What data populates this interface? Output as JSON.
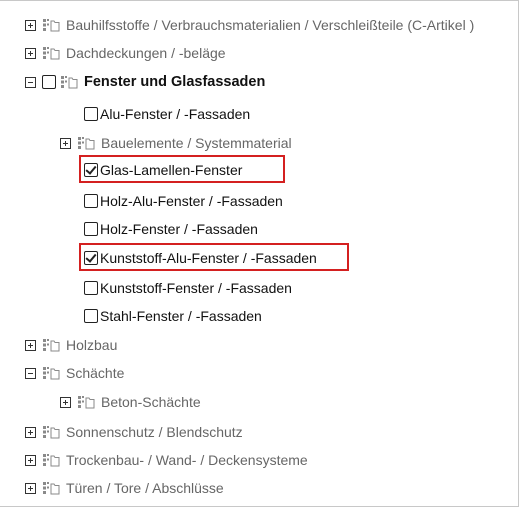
{
  "tree": {
    "items": [
      {
        "label": "Bauhilfsstoffe / Verbrauchsmaterialien / Verschleißteile (C-Artikel )",
        "toggle": "plus",
        "icon": "folder-tree-icon"
      },
      {
        "label": "Dachdeckungen / -beläge",
        "toggle": "plus",
        "icon": "folder-tree-icon"
      },
      {
        "label": "Fenster und Glasfassaden",
        "toggle": "minus",
        "icon": "folder-tree-icon",
        "checked": false,
        "expanded": true
      },
      {
        "label": "Alu-Fenster / -Fassaden",
        "checked": false
      },
      {
        "label": "Bauelemente / Systemmaterial",
        "toggle": "plus",
        "icon": "folder-tree-icon"
      },
      {
        "label": "Glas-Lamellen-Fenster",
        "checked": true,
        "highlighted": true
      },
      {
        "label": "Holz-Alu-Fenster / -Fassaden",
        "checked": false
      },
      {
        "label": "Holz-Fenster / -Fassaden",
        "checked": false
      },
      {
        "label": "Kunststoff-Alu-Fenster / -Fassaden",
        "checked": true,
        "highlighted": true
      },
      {
        "label": "Kunststoff-Fenster / -Fassaden",
        "checked": false
      },
      {
        "label": "Stahl-Fenster / -Fassaden",
        "checked": false
      },
      {
        "label": "Holzbau",
        "toggle": "plus",
        "icon": "folder-tree-icon"
      },
      {
        "label": "Schächte",
        "toggle": "minus",
        "icon": "folder-tree-icon",
        "expanded": true
      },
      {
        "label": "Beton-Schächte",
        "toggle": "plus",
        "icon": "folder-tree-icon"
      },
      {
        "label": "Sonnenschutz / Blendschutz",
        "toggle": "plus",
        "icon": "folder-tree-icon"
      },
      {
        "label": "Trockenbau- / Wand- / Deckensysteme",
        "toggle": "plus",
        "icon": "folder-tree-icon"
      },
      {
        "label": "Türen / Tore / Abschlüsse",
        "toggle": "plus",
        "icon": "folder-tree-icon"
      }
    ]
  },
  "colors": {
    "highlight": "#d42020",
    "muted_text": "#666666",
    "icon_gray": "#888888"
  }
}
